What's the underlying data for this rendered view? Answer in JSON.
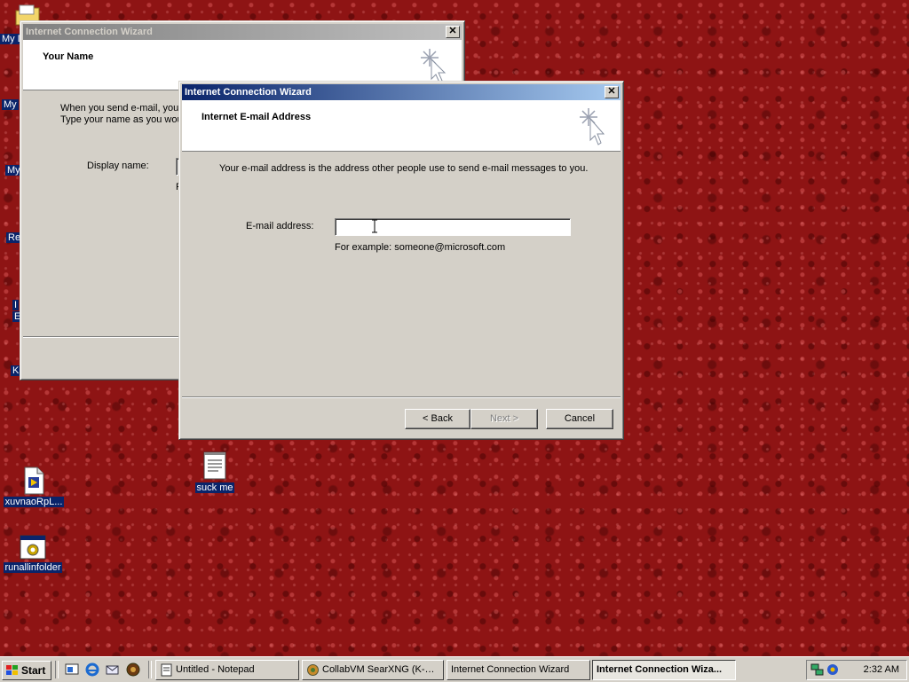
{
  "desktop": {
    "left_clipped_labels": [
      "My D",
      "My",
      "My",
      "Re",
      "I",
      "E",
      "K"
    ],
    "icons": [
      {
        "label": "xuvnaoRpL..."
      },
      {
        "label": "runallinfolder"
      },
      {
        "label": "suck me"
      }
    ]
  },
  "back_wizard": {
    "title": "Internet Connection Wizard",
    "close_glyph": "✕",
    "header_title": "Your Name",
    "body_line1": "When you send e-mail, your",
    "body_line2": "Type your name as you wou",
    "display_name_label": "Display name:",
    "field_hint_partial": "F"
  },
  "front_wizard": {
    "title": "Internet Connection Wizard",
    "close_glyph": "✕",
    "header_title": "Internet E-mail Address",
    "description": "Your e-mail address is the address other people use to send e-mail messages to you.",
    "email_label": "E-mail address:",
    "email_value": "",
    "example_text": "For example: someone@microsoft.com",
    "back_button": "< Back",
    "next_button": "Next >",
    "cancel_button": "Cancel"
  },
  "taskbar": {
    "start_label": "Start",
    "quick_launch": [
      "show-desktop-icon",
      "internet-explorer-icon",
      "outlook-express-icon",
      "media-player-icon"
    ],
    "tasks": [
      {
        "label": "Untitled - Notepad",
        "active": false
      },
      {
        "label": "CollabVM SearXNG (K-Mel...",
        "active": false
      },
      {
        "label": "Internet Connection Wizard",
        "active": false
      },
      {
        "label": "Internet Connection Wiza...",
        "active": true
      }
    ],
    "clock": "2:32 AM"
  },
  "colors": {
    "desktop": "#8e1414",
    "title_active": "#0a246a",
    "title_inactive": "#808080",
    "window_face": "#d4d0c8"
  }
}
